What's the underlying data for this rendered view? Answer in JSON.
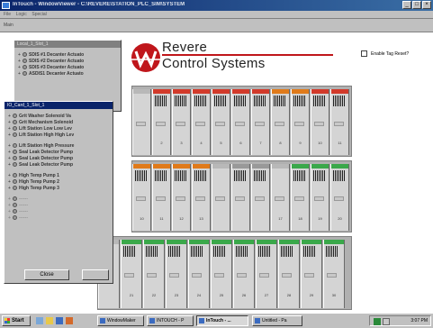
{
  "window": {
    "title": "InTouch - WindowViewer - C:\\REVERE\\STATION_PLC_SIM\\SYSTEM"
  },
  "menu": {
    "items": [
      "File",
      "Logic",
      "Special"
    ]
  },
  "toolbar": {
    "label": "Main"
  },
  "logo": {
    "line1": "Revere",
    "line2": "Control Systems"
  },
  "tag_reset": {
    "label": "Enable Tag Reset?"
  },
  "back_panel": {
    "title": "Local_1_Slot_1",
    "items": [
      "SDIS #1 Decanter Actuato",
      "SDIS #2 Decanter Actuato",
      "SDIS #3 Decanter Actuato",
      "ASDIS1 Decanter Actuato"
    ]
  },
  "front_panel": {
    "title": "IO_Card_1_Slot_1",
    "items": [
      "Grit Washer Solenoid Va",
      "Grit Mechanism Solenoid",
      "Lift Station Low Low Lev",
      "Lift Station High High Lev",
      "Lift Station High Pressure",
      "Seal Leak Detector Pump",
      "Seal Leak Detector Pump",
      "Seal Leak Detector Pump",
      "High Temp Pump 1",
      "High Temp Pump 2",
      "High Temp Pump 3",
      "------",
      "------",
      "------",
      "------"
    ],
    "close_label": "Close"
  },
  "rack1": {
    "numbers": [
      "",
      "2",
      "3",
      "4",
      "5",
      "6",
      "7",
      "8",
      "9",
      "10",
      "11"
    ]
  },
  "rack2": {
    "numbers": [
      "10",
      "11",
      "12",
      "13",
      "",
      "",
      "",
      "17",
      "18",
      "19",
      "20"
    ]
  },
  "rack3": {
    "numbers": [
      "",
      "21",
      "22",
      "23",
      "24",
      "25",
      "26",
      "27",
      "28",
      "29",
      "30"
    ]
  },
  "taskbar": {
    "start": "Start",
    "buttons": [
      "WindowMaker",
      "INTOUCH - P",
      "InTouch - ...",
      "Untitled - Pa"
    ],
    "active_index": 2,
    "clock": "3:07 PM"
  },
  "colors": {
    "brand_red": "#c0161b",
    "titlebar": "#0a246a",
    "module_red": "#d23a2a",
    "module_orange": "#e07a1a",
    "module_green": "#3aa84a"
  }
}
